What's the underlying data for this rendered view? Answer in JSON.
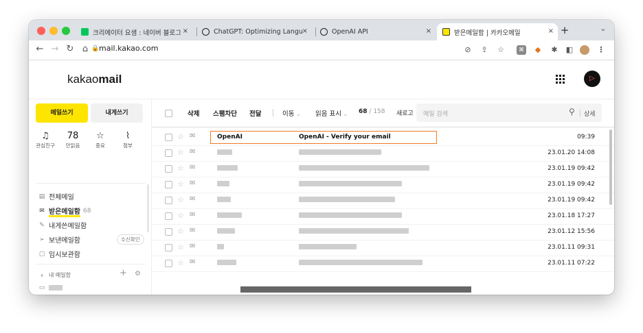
{
  "browser": {
    "tabs": [
      {
        "title": "크리에이터 요샘 : 네이버 블로그",
        "favicon_color": "#03c75a",
        "active": false
      },
      {
        "title": "ChatGPT: Optimizing Langua",
        "favicon_color": "#202124",
        "active": false
      },
      {
        "title": "OpenAI API",
        "favicon_color": "#202124",
        "active": false
      },
      {
        "title": "받은메일함 | 카카오메일",
        "favicon_color": "#fee500",
        "active": true
      }
    ],
    "new_tab": "+",
    "tab_menu": "⌄",
    "close_glyph": "×",
    "url": "mail.kakao.com",
    "traffic_colors": [
      "#ff5f57",
      "#febc2e",
      "#28c840"
    ]
  },
  "kakao": {
    "logo_light": "kakao",
    "logo_bold": "mail"
  },
  "sidebar": {
    "write_to_me": "메일쓰기",
    "compose": "내게쓰기",
    "quick": [
      {
        "icon": "bell-icon",
        "glyph": "🔔",
        "label": "관심친구",
        "is_number": false
      },
      {
        "icon": "unread-count",
        "glyph": "78",
        "label": "안읽음",
        "is_number": true
      },
      {
        "icon": "star-icon",
        "glyph": "☆",
        "label": "중요",
        "is_number": false
      },
      {
        "icon": "paperclip-icon",
        "glyph": "🖇",
        "label": "첨부",
        "is_number": false
      }
    ],
    "items": [
      {
        "label": "전체메일",
        "icon": "mailbox-icon",
        "glyph": "▤",
        "count": ""
      },
      {
        "label": "받은메일함",
        "icon": "inbox-icon",
        "glyph": "✉",
        "count": "68"
      },
      {
        "label": "내게쓴메일함",
        "icon": "self-mail-icon",
        "glyph": "✎",
        "count": ""
      },
      {
        "label": "보낸메일함",
        "icon": "sent-icon",
        "glyph": "➢",
        "count": ""
      },
      {
        "label": "임시보관함",
        "icon": "draft-icon",
        "glyph": "▢",
        "count": ""
      }
    ],
    "read_receipt": "수신확인",
    "my_mailbox": "내 메일함",
    "add": "+",
    "settings": "⚙"
  },
  "toolbar": {
    "delete": "삭제",
    "spam": "스팸차단",
    "forward": "전달",
    "move": "이동",
    "read_mark": "읽음 표시",
    "count_current": "68",
    "count_sep": "/",
    "count_total": "158",
    "new_label": "새로고",
    "search_placeholder": "메일 검색",
    "detail": "상세"
  },
  "emails": [
    {
      "sender": "OpenAI",
      "subject": "OpenAI - Verify your email",
      "date": "09:39",
      "blurred": false
    },
    {
      "sender": "",
      "subject": "",
      "date": "23.01.20 14:08",
      "blurred": true
    },
    {
      "sender": "",
      "subject": "",
      "date": "23.01.19 09:42",
      "blurred": true
    },
    {
      "sender": "",
      "subject": "",
      "date": "23.01.19 09:42",
      "blurred": true
    },
    {
      "sender": "",
      "subject": "",
      "date": "23.01.19 09:42",
      "blurred": true
    },
    {
      "sender": "",
      "subject": "",
      "date": "23.01.18 17:27",
      "blurred": true
    },
    {
      "sender": "",
      "subject": "",
      "date": "23.01.12 15:56",
      "blurred": true
    },
    {
      "sender": "",
      "subject": "",
      "date": "23.01.11 09:31",
      "blurred": true
    },
    {
      "sender": "",
      "subject": "",
      "date": "23.01.11 07:22",
      "blurred": true
    }
  ]
}
